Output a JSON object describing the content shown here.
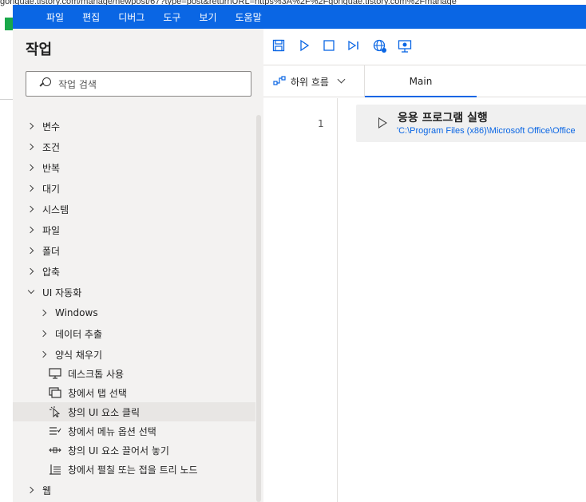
{
  "browser": {
    "url_fragment": "gonguae.tistory.com/manage/newpost/67?type=post&returnURL=https%3A%2F%2Fgonguae.tistory.com%2Fmanage"
  },
  "menubar": {
    "items": [
      "파일",
      "편집",
      "디버그",
      "도구",
      "보기",
      "도움말"
    ]
  },
  "actions_panel": {
    "title": "작업",
    "search_placeholder": "작업 검색",
    "tree": [
      {
        "label": "변수",
        "state": "collapsed"
      },
      {
        "label": "조건",
        "state": "collapsed"
      },
      {
        "label": "반복",
        "state": "collapsed"
      },
      {
        "label": "대기",
        "state": "collapsed"
      },
      {
        "label": "시스템",
        "state": "collapsed"
      },
      {
        "label": "파일",
        "state": "collapsed"
      },
      {
        "label": "폴더",
        "state": "collapsed"
      },
      {
        "label": "압축",
        "state": "collapsed"
      },
      {
        "label": "UI 자동화",
        "state": "expanded"
      },
      {
        "label": "Windows",
        "state": "collapsed"
      },
      {
        "label": "데이터 추출",
        "state": "collapsed"
      },
      {
        "label": "양식 채우기",
        "state": "collapsed"
      },
      {
        "label": "데스크톱 사용",
        "icon": "desktop-icon"
      },
      {
        "label": "창에서 탭 선택",
        "icon": "tab-select-icon"
      },
      {
        "label": "창의 UI 요소 클릭",
        "icon": "click-pointer-icon"
      },
      {
        "label": "창에서 메뉴 옵션 선택",
        "icon": "menu-option-icon"
      },
      {
        "label": "창의 UI 요소 끌어서 놓기",
        "icon": "drag-drop-icon"
      },
      {
        "label": "창에서 펼칠 또는 접을 트리 노드",
        "icon": "tree-node-icon"
      },
      {
        "label": "웹",
        "state": "collapsed"
      }
    ]
  },
  "toolbar": {
    "buttons": [
      "save-icon",
      "run-icon",
      "stop-icon",
      "step-icon",
      "web-recorder-icon",
      "desktop-recorder-icon"
    ]
  },
  "tabs": {
    "subflow_label": "하위 흐름",
    "main_label": "Main"
  },
  "editor": {
    "line_number": "1",
    "action_title": "응용 프로그램 실행",
    "action_path": "'C:\\Program Files (x86)\\Microsoft Office\\Office"
  },
  "colors": {
    "accent": "#0a66e4",
    "panel_bg": "#f3f2f1",
    "action_bg": "#f0f0f0"
  }
}
